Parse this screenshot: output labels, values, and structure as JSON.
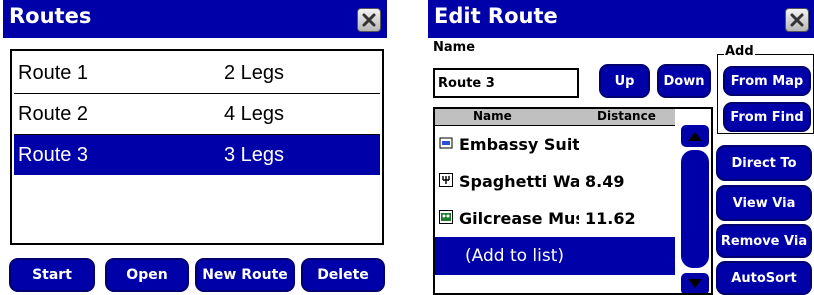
{
  "routes_window": {
    "title": "Routes",
    "close_icon": "close-x-icon",
    "routes": [
      {
        "name": "Route 1",
        "legs": "2 Legs",
        "selected": false
      },
      {
        "name": "Route 2",
        "legs": "4 Legs",
        "selected": false
      },
      {
        "name": "Route 3",
        "legs": "3 Legs",
        "selected": true
      }
    ],
    "buttons": {
      "start": "Start",
      "open": "Open",
      "new_route": "New Route",
      "delete": "Delete"
    }
  },
  "edit_route_window": {
    "title": "Edit Route",
    "close_icon": "close-x-icon",
    "name_label": "Name",
    "name_value": "Route 3",
    "buttons": {
      "up": "Up",
      "down": "Down",
      "from_map": "From Map",
      "from_find": "From Find",
      "direct_to": "Direct To",
      "view_via": "View Via",
      "remove_via": "Remove Via",
      "autosort": "AutoSort"
    },
    "add_label": "Add",
    "columns": {
      "name": "Name",
      "distance": "Distance"
    },
    "waypoints": [
      {
        "name": "Embassy Suit",
        "distance": "",
        "icon": "hotel-icon"
      },
      {
        "name": "Spaghetti Wa",
        "distance": "8.49",
        "icon": "restaurant-icon"
      },
      {
        "name": "Gilcrease Mus",
        "distance": "11.62",
        "icon": "attraction-icon"
      }
    ],
    "add_to_list": "(Add to list)"
  },
  "colors": {
    "accent": "#0000a8",
    "title_text": "#ffffff"
  }
}
